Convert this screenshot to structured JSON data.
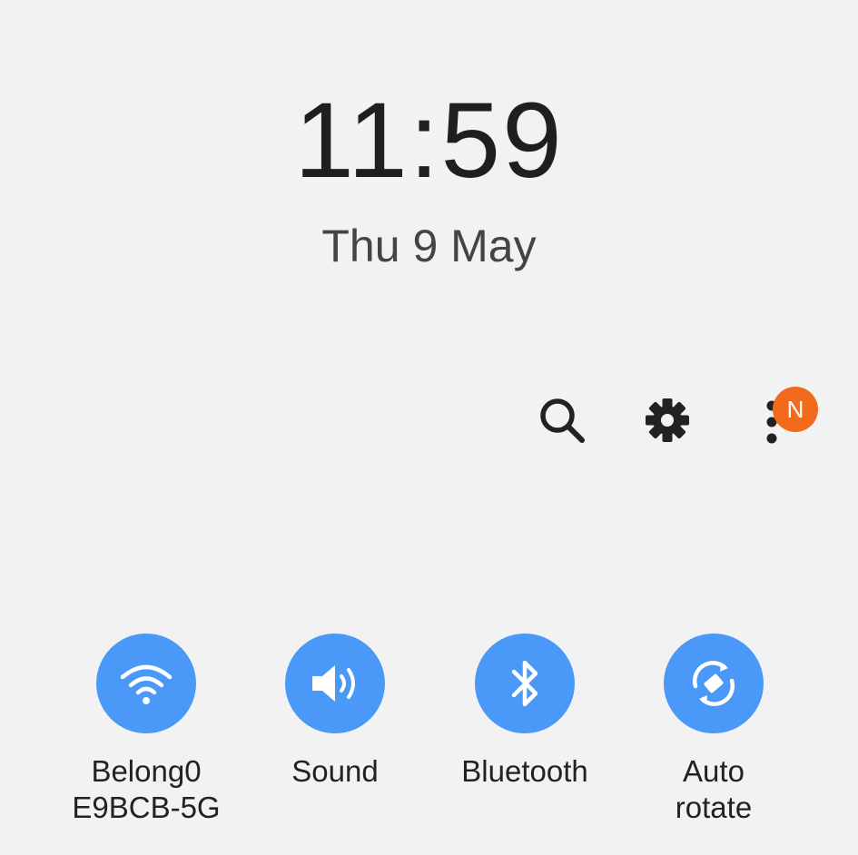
{
  "lock": {
    "time": "11:59",
    "date": "Thu 9 May"
  },
  "toolbar": {
    "search_icon": "search-icon",
    "settings_icon": "gear-icon",
    "more_icon": "more-vert-icon",
    "notification_badge": "N",
    "badge_color": "#f26b1d"
  },
  "quick_settings": {
    "accent_color": "#4a98f7",
    "tiles": [
      {
        "icon": "wifi-icon",
        "label": "Belong0\nE9BCB-5G"
      },
      {
        "icon": "sound-icon",
        "label": "Sound"
      },
      {
        "icon": "bluetooth-icon",
        "label": "Bluetooth"
      },
      {
        "icon": "auto-rotate-icon",
        "label": "Auto\nrotate"
      }
    ]
  }
}
